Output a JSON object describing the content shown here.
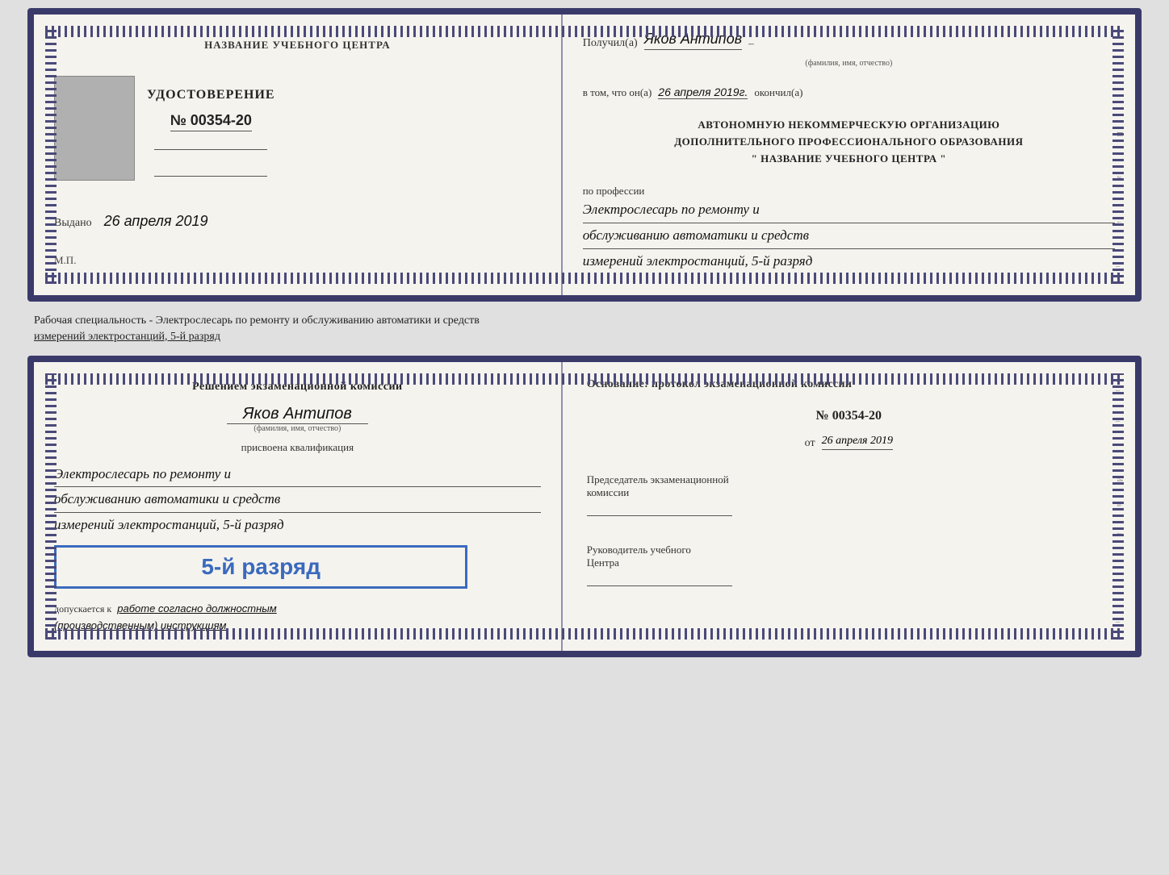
{
  "top_doc": {
    "left": {
      "institution_label": "НАЗВАНИЕ УЧЕБНОГО ЦЕНТРА",
      "cert_title": "УДОСТОВЕРЕНИЕ",
      "cert_number": "№ 00354-20",
      "issued_label": "Выдано",
      "issued_date": "26 апреля 2019",
      "mp_label": "М.П."
    },
    "right": {
      "received_label": "Получил(а)",
      "recipient_name": "Яков Антипов",
      "fio_label": "(фамилия, имя, отчество)",
      "cert_text": "в том, что он(а)",
      "cert_date": "26 апреля 2019г.",
      "finished_label": "окончил(а)",
      "org_line1": "АВТОНОМНУЮ НЕКОММЕРЧЕСКУЮ ОРГАНИЗАЦИЮ",
      "org_line2": "ДОПОЛНИТЕЛЬНОГО ПРОФЕССИОНАЛЬНОГО ОБРАЗОВАНИЯ",
      "org_quote": "\"  НАЗВАНИЕ УЧЕБНОГО ЦЕНТРА  \"",
      "profession_label": "по профессии",
      "profession_line1": "Электрослесарь по ремонту и",
      "profession_line2": "обслуживанию автоматики и средств",
      "profession_line3": "измерений электростанций, 5-й разряд"
    }
  },
  "specialty_text": "Рабочая специальность - Электрослесарь по ремонту и обслуживанию автоматики и средств\nизмерений электростанций, 5-й разряд",
  "bottom_doc": {
    "left": {
      "commission_title_line1": "Решением экзаменационной комиссии",
      "person_name": "Яков Антипов",
      "fio_label": "(фамилия, имя, отчество)",
      "qualification_label": "присвоена квалификация",
      "qual_line1": "Электрослесарь по ремонту и",
      "qual_line2": "обслуживанию автоматики и средств",
      "qual_line3": "измерений электростанций, 5-й разряд",
      "rank_badge": "5-й разряд",
      "allowed_label": "допускается к",
      "allowed_text": "работе согласно должностным",
      "allowed_text2": "(производственным) инструкциям"
    },
    "right": {
      "basis_label": "Основание: протокол экзаменационной комиссии",
      "number": "№  00354-20",
      "from_label": "от",
      "from_date": "26 апреля 2019",
      "chairman_label": "Председатель экзаменационной",
      "chairman_label2": "комиссии",
      "director_label": "Руководитель учебного",
      "director_label2": "Центра"
    }
  }
}
